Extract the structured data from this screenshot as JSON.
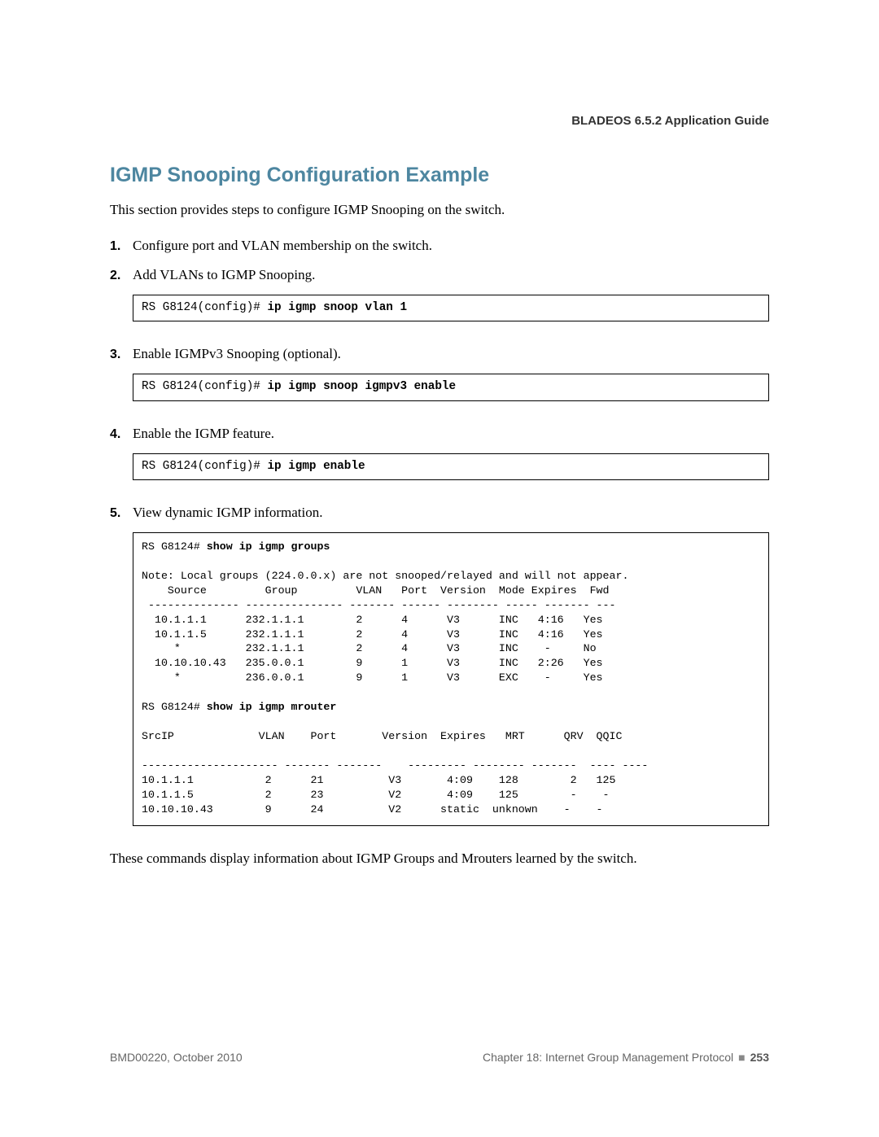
{
  "header": {
    "title": "BLADEOS 6.5.2 Application Guide"
  },
  "section": {
    "title": "IGMP Snooping Configuration Example",
    "intro": "This section provides steps to configure IGMP Snooping on the switch."
  },
  "steps": [
    {
      "num": "1.",
      "text": "Configure port and VLAN membership on the switch."
    },
    {
      "num": "2.",
      "text": "Add VLANs to IGMP Snooping."
    },
    {
      "num": "3.",
      "text": "Enable IGMPv3 Snooping (optional)."
    },
    {
      "num": "4.",
      "text": "Enable the IGMP feature."
    },
    {
      "num": "5.",
      "text": "View dynamic IGMP information."
    }
  ],
  "cmds": {
    "prompt_config": "RS G8124(config)# ",
    "prompt_exec": "RS G8124# ",
    "snoop_vlan": "ip igmp snoop vlan 1",
    "snoop_v3": "ip igmp snoop igmpv3 enable",
    "igmp_enable": "ip igmp enable",
    "show_groups": "show ip igmp groups",
    "show_mrouter": "show ip igmp mrouter"
  },
  "groups_output": {
    "note": "Note: Local groups (224.0.0.x) are not snooped/relayed and will not appear.",
    "header": "    Source         Group         VLAN   Port  Version  Mode Expires  Fwd",
    "divider": " -------------- --------------- ------- ------ -------- ----- ------- ---",
    "rows": [
      "  10.1.1.1      232.1.1.1        2      4      V3      INC   4:16   Yes",
      "  10.1.1.5      232.1.1.1        2      4      V3      INC   4:16   Yes",
      "     *          232.1.1.1        2      4      V3      INC    -     No",
      "  10.10.10.43   235.0.0.1        9      1      V3      INC   2:26   Yes",
      "     *          236.0.0.1        9      1      V3      EXC    -     Yes"
    ]
  },
  "mrouter_output": {
    "header": "SrcIP             VLAN    Port       Version  Expires   MRT      QRV  QQIC",
    "divider": "--------------------- ------- -------    --------- -------- -------  ---- ----",
    "rows": [
      "10.1.1.1           2      21          V3       4:09    128        2   125",
      "10.1.1.5           2      23          V2       4:09    125        -    -",
      "10.10.10.43        9      24          V2      static  unknown    -    -"
    ]
  },
  "trailing": "These commands display information about IGMP Groups and Mrouters learned by the switch.",
  "footer": {
    "left": "BMD00220, October 2010",
    "chapter": "Chapter 18: Internet Group Management Protocol",
    "pagenum": "253"
  }
}
